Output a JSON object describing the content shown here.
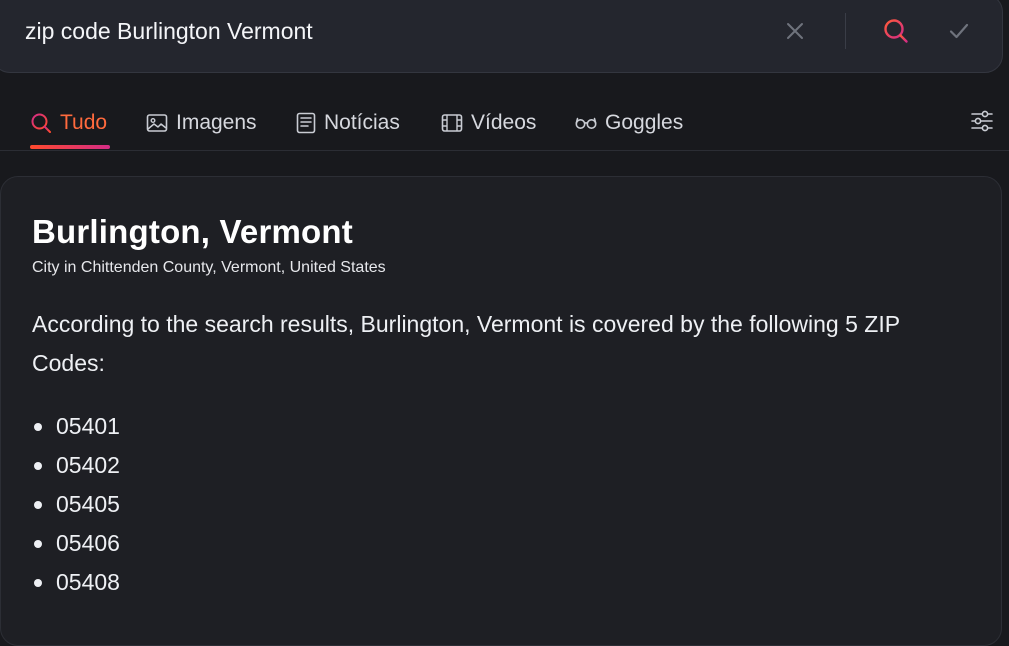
{
  "search": {
    "query": "zip code Burlington Vermont"
  },
  "tabs": [
    {
      "label": "Tudo",
      "icon": "search-icon",
      "active": true
    },
    {
      "label": "Imagens",
      "icon": "image-icon",
      "active": false
    },
    {
      "label": "Notícias",
      "icon": "news-icon",
      "active": false
    },
    {
      "label": "Vídeos",
      "icon": "film-icon",
      "active": false
    },
    {
      "label": "Goggles",
      "icon": "glasses-icon",
      "active": false
    }
  ],
  "result": {
    "title": "Burlington, Vermont",
    "subtitle": "City in Chittenden County, Vermont, United States",
    "answer": "According to the search results, Burlington, Vermont is covered by the following 5 ZIP Codes:",
    "zip_codes": [
      "05401",
      "05402",
      "05405",
      "05406",
      "05408"
    ]
  },
  "colors": {
    "background": "#18191d",
    "accent_orange": "#ff6a3d",
    "accent_pink": "#d42c86",
    "card_background": "#1e1f24"
  }
}
